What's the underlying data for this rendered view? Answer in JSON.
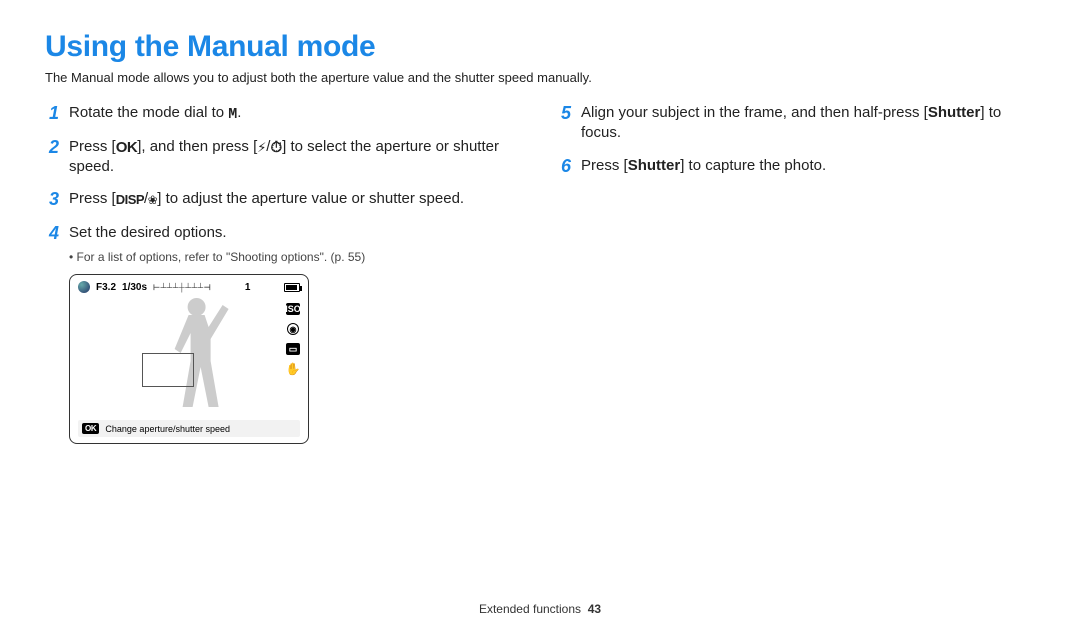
{
  "title": "Using the Manual mode",
  "intro": "The Manual mode allows you to adjust both the aperture value and the shutter speed manually.",
  "steps": {
    "s1": {
      "num": "1",
      "before": "Rotate the mode dial to ",
      "glyph": "M",
      "after": "."
    },
    "s2": {
      "num": "2",
      "p1": "Press [",
      "ok": "OK",
      "p2": "], and then press [",
      "flash": "⚡",
      "slash": "/",
      "timer": "⏱",
      "p3": "] to select the aperture or shutter speed."
    },
    "s3": {
      "num": "3",
      "p1": "Press [",
      "disp": "DISP",
      "slash": "/",
      "macro": "❀",
      "p2": "] to adjust the aperture value or shutter speed."
    },
    "s4": {
      "num": "4",
      "text": "Set the desired options.",
      "note": "For a list of options, refer to \"Shooting options\". (p. 55)"
    },
    "s5": {
      "num": "5",
      "p1": "Align your subject in the frame, and then half-press [",
      "b": "Shutter",
      "p2": "] to focus."
    },
    "s6": {
      "num": "6",
      "p1": "Press [",
      "b": "Shutter",
      "p2": "] to capture the photo."
    }
  },
  "screen": {
    "aperture": "F3.2",
    "shutter": "1/30s",
    "ev_scale": "-2..0..+2",
    "counter": "1",
    "iso_label": "ISO",
    "footer_ok": "OK",
    "footer_text": "Change aperture/shutter speed"
  },
  "footer": {
    "section": "Extended functions",
    "page": "43"
  }
}
